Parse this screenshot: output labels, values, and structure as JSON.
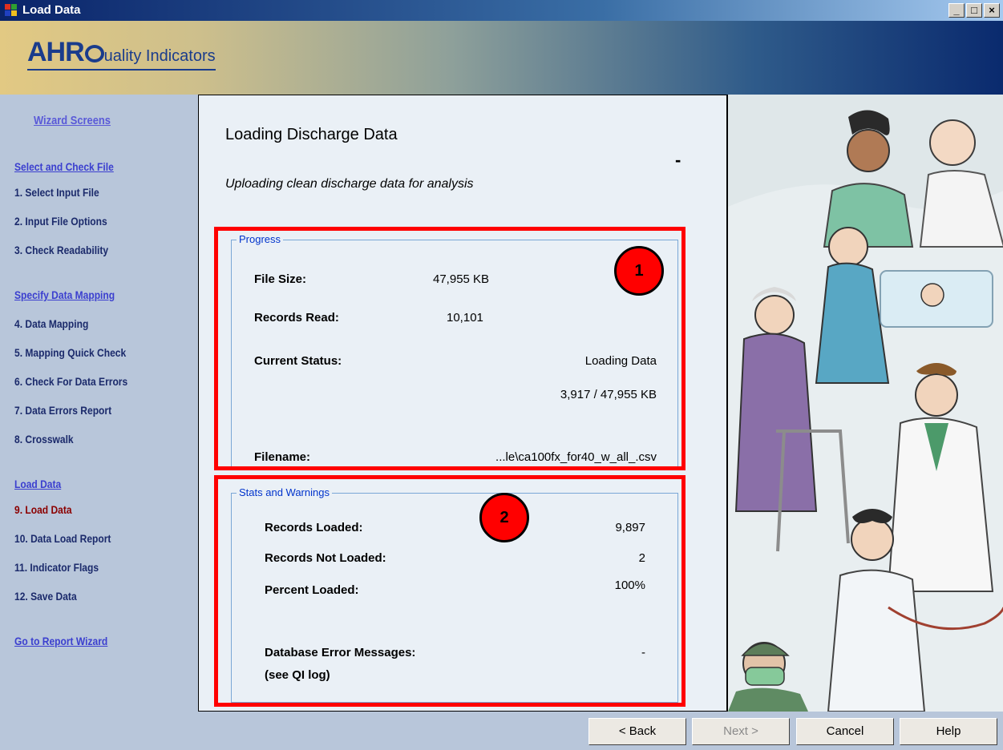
{
  "window": {
    "title": "Load Data"
  },
  "banner": {
    "logo_big": "AHR",
    "logo_small": "uality Indicators"
  },
  "sidebar": {
    "heading": "Wizard Screens",
    "items": [
      {
        "label": "Select and Check File",
        "type": "link"
      },
      {
        "label": "1. Select Input File",
        "type": "step"
      },
      {
        "label": "2. Input File Options",
        "type": "step"
      },
      {
        "label": "3. Check Readability",
        "type": "step"
      },
      {
        "label": "Specify Data Mapping",
        "type": "link"
      },
      {
        "label": "4. Data Mapping",
        "type": "step"
      },
      {
        "label": "5. Mapping Quick Check",
        "type": "step"
      },
      {
        "label": "6. Check For Data Errors",
        "type": "step"
      },
      {
        "label": "7. Data Errors Report",
        "type": "step"
      },
      {
        "label": "8. Crosswalk",
        "type": "step"
      },
      {
        "label": "Load Data",
        "type": "link"
      },
      {
        "label": "9. Load Data",
        "type": "active"
      },
      {
        "label": "10. Data Load Report",
        "type": "step"
      },
      {
        "label": "11. Indicator Flags",
        "type": "step"
      },
      {
        "label": "12. Save Data",
        "type": "step"
      },
      {
        "label": "Go to Report Wizard",
        "type": "link"
      }
    ]
  },
  "content": {
    "title": "Loading Discharge Data",
    "dash": "-",
    "subtitle": "Uploading clean discharge data for analysis"
  },
  "progress": {
    "legend": "Progress",
    "file_size_label": "File Size:",
    "file_size_value": "47,955 KB",
    "records_read_label": "Records Read:",
    "records_read_value": "10,101",
    "current_status_label": "Current Status:",
    "current_status_value": "Loading Data",
    "current_status_detail": "3,917 / 47,955 KB",
    "filename_label": "Filename:",
    "filename_value": "...le\\ca100fx_for40_w_all_.csv"
  },
  "stats": {
    "legend": "Stats and Warnings",
    "records_loaded_label": "Records Loaded:",
    "records_loaded_value": "9,897",
    "records_not_loaded_label": "Records Not Loaded:",
    "records_not_loaded_value": "2",
    "percent_loaded_label": "Percent Loaded:",
    "percent_loaded_value": "100%",
    "db_errors_label": "Database Error Messages:",
    "db_errors_sub": "(see QI log)",
    "db_errors_value": "-"
  },
  "callouts": [
    "1",
    "2"
  ],
  "buttons": {
    "back": "< Back",
    "next": "Next >",
    "cancel": "Cancel",
    "help": "Help"
  },
  "colors": {
    "highlight": "#ff0000",
    "sidebar_bg": "#b8c6da",
    "content_bg": "#eaf0f6",
    "active_step": "#8b0000"
  }
}
